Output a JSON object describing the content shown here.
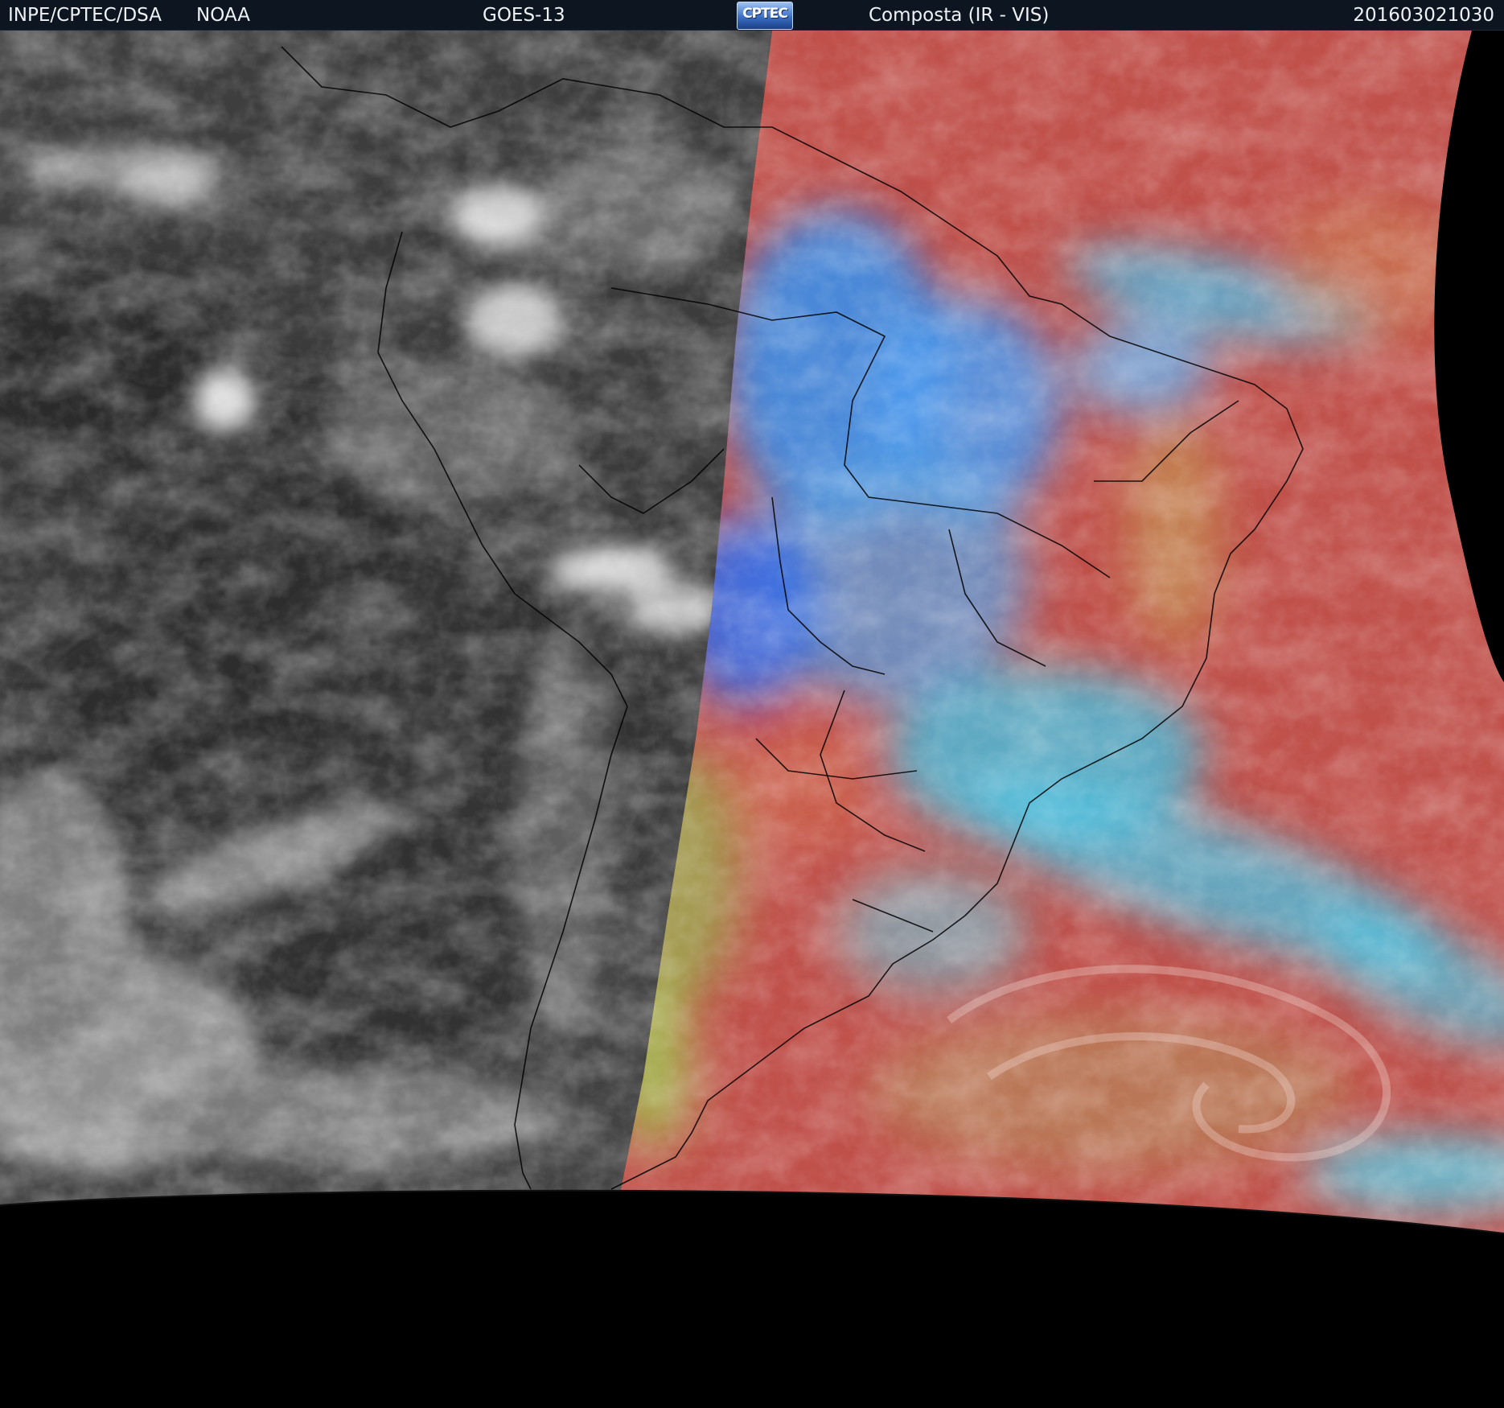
{
  "header": {
    "organization": "INPE/CPTEC/DSA",
    "agency": "NOAA",
    "satellite": "GOES-13",
    "logo_text": "CPTEC",
    "product": "Composta (IR - VIS)",
    "timestamp": "201603021030"
  },
  "colors": {
    "header_bg": "#0d1620",
    "header_text": "#eef2f6",
    "background": "#000000",
    "ir_gray": "#4a4a4a",
    "composite_red": "#c0504a",
    "composite_blue": "#3f8fe8",
    "composite_cyan": "#47c8e0",
    "composite_green": "#8cd95a",
    "coastline": "#000000"
  },
  "scene": {
    "left_panel": "infrared-grayscale",
    "right_panel": "ir-vis-composite"
  }
}
